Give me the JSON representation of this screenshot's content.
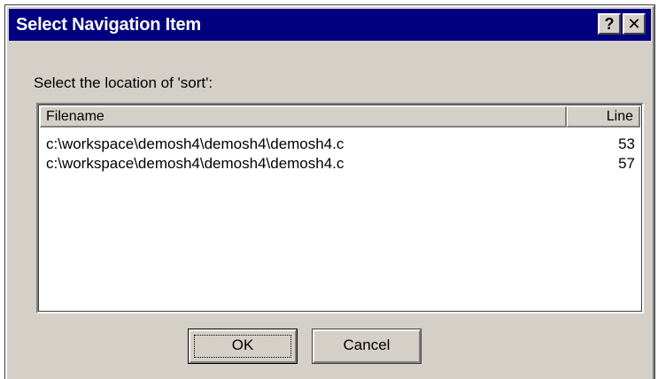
{
  "window": {
    "title": "Select Navigation Item",
    "help_label": "?",
    "close_label": "✕"
  },
  "prompt": "Select the location of 'sort':",
  "list": {
    "columns": [
      "Filename",
      "Line"
    ],
    "rows": [
      {
        "filename": "c:\\workspace\\demosh4\\demosh4\\demosh4.c",
        "line": "53"
      },
      {
        "filename": "c:\\workspace\\demosh4\\demosh4\\demosh4.c",
        "line": "57"
      }
    ]
  },
  "buttons": {
    "ok": "OK",
    "cancel": "Cancel"
  },
  "colors": {
    "titlebar": "#000080",
    "face": "#d4d0c8"
  }
}
